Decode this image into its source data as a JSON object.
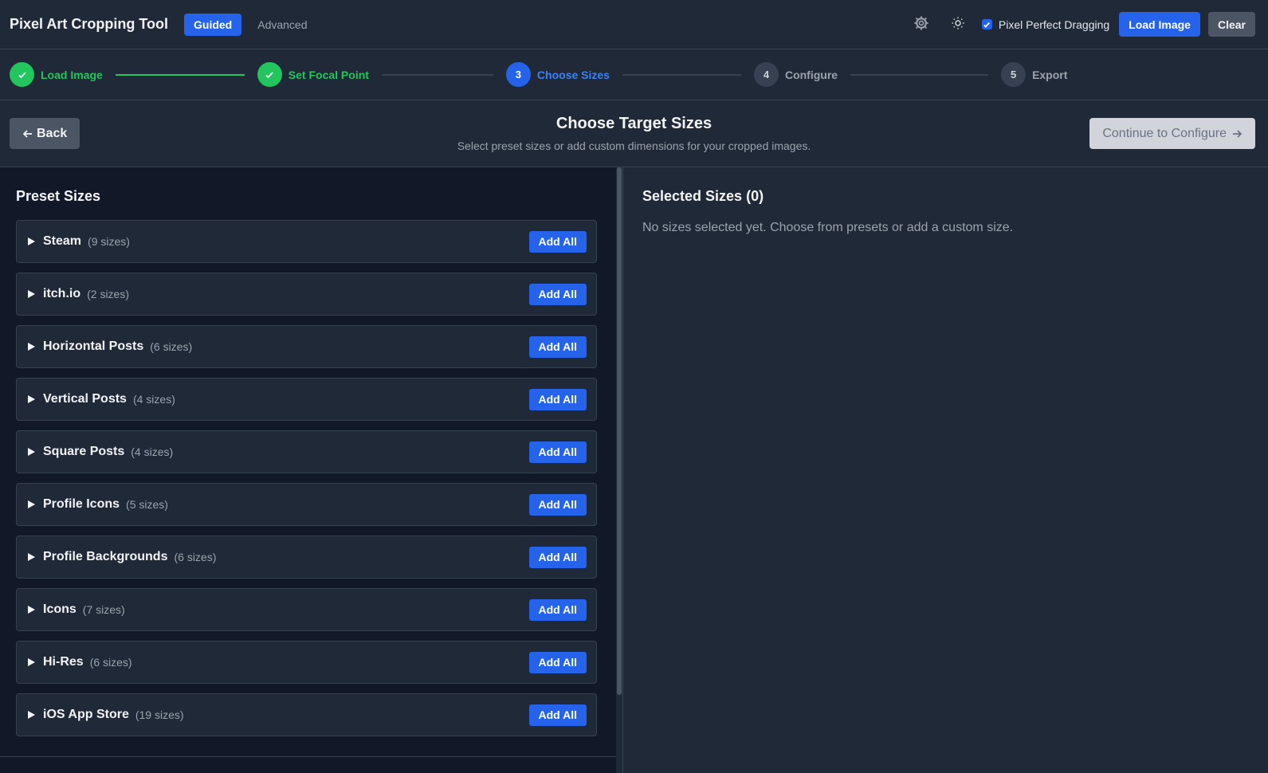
{
  "header": {
    "title": "Pixel Art Cropping Tool",
    "modes": [
      {
        "label": "Guided",
        "active": true
      },
      {
        "label": "Advanced",
        "active": false
      }
    ],
    "icons": [
      "gear-icon",
      "sun-icon"
    ],
    "pixel_perfect_label": "Pixel Perfect Dragging",
    "pixel_perfect_checked": true,
    "load_image_label": "Load Image",
    "clear_label": "Clear"
  },
  "stepper": {
    "steps": [
      {
        "number": "1",
        "label": "Load Image",
        "state": "done"
      },
      {
        "number": "2",
        "label": "Set Focal Point",
        "state": "done"
      },
      {
        "number": "3",
        "label": "Choose Sizes",
        "state": "current"
      },
      {
        "number": "4",
        "label": "Configure",
        "state": "pending"
      },
      {
        "number": "5",
        "label": "Export",
        "state": "pending"
      }
    ]
  },
  "subheader": {
    "back_label": "Back",
    "title": "Choose Target Sizes",
    "description": "Select preset sizes or add custom dimensions for your cropped images.",
    "continue_label": "Continue to Configure"
  },
  "presets": {
    "title": "Preset Sizes",
    "add_all_label": "Add All",
    "groups": [
      {
        "name": "Steam",
        "count": "(9 sizes)"
      },
      {
        "name": "itch.io",
        "count": "(2 sizes)"
      },
      {
        "name": "Horizontal Posts",
        "count": "(6 sizes)"
      },
      {
        "name": "Vertical Posts",
        "count": "(4 sizes)"
      },
      {
        "name": "Square Posts",
        "count": "(4 sizes)"
      },
      {
        "name": "Profile Icons",
        "count": "(5 sizes)"
      },
      {
        "name": "Profile Backgrounds",
        "count": "(6 sizes)"
      },
      {
        "name": "Icons",
        "count": "(7 sizes)"
      },
      {
        "name": "Hi-Res",
        "count": "(6 sizes)"
      },
      {
        "name": "iOS App Store",
        "count": "(19 sizes)"
      }
    ]
  },
  "selected": {
    "title": "Selected Sizes (0)",
    "empty_text": "No sizes selected yet. Choose from presets or add a custom size."
  },
  "colors": {
    "accent": "#2563eb",
    "success": "#22c55e",
    "background": "#111827",
    "panel": "#1f2937"
  }
}
